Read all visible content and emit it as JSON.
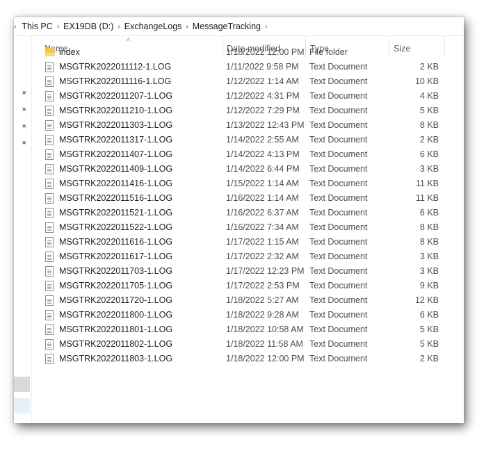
{
  "breadcrumb": {
    "items": [
      "This PC",
      "EX19DB (D:)",
      "ExchangeLogs",
      "MessageTracking"
    ]
  },
  "columns": {
    "name": "Name",
    "date_modified": "Date modified",
    "type": "Type",
    "size": "Size"
  },
  "files": [
    {
      "name": "index",
      "date": "1/18/2022 12:00 PM",
      "type": "File folder",
      "size": "",
      "icon": "folder-icon"
    },
    {
      "name": "MSGTRK2022011112-1.LOG",
      "date": "1/11/2022 9:58 PM",
      "type": "Text Document",
      "size": "2 KB",
      "icon": "text-document-icon"
    },
    {
      "name": "MSGTRK2022011116-1.LOG",
      "date": "1/12/2022 1:14 AM",
      "type": "Text Document",
      "size": "10 KB",
      "icon": "text-document-icon"
    },
    {
      "name": "MSGTRK2022011207-1.LOG",
      "date": "1/12/2022 4:31 PM",
      "type": "Text Document",
      "size": "4 KB",
      "icon": "text-document-icon"
    },
    {
      "name": "MSGTRK2022011210-1.LOG",
      "date": "1/12/2022 7:29 PM",
      "type": "Text Document",
      "size": "5 KB",
      "icon": "text-document-icon"
    },
    {
      "name": "MSGTRK2022011303-1.LOG",
      "date": "1/13/2022 12:43 PM",
      "type": "Text Document",
      "size": "8 KB",
      "icon": "text-document-icon"
    },
    {
      "name": "MSGTRK2022011317-1.LOG",
      "date": "1/14/2022 2:55 AM",
      "type": "Text Document",
      "size": "2 KB",
      "icon": "text-document-icon"
    },
    {
      "name": "MSGTRK2022011407-1.LOG",
      "date": "1/14/2022 4:13 PM",
      "type": "Text Document",
      "size": "6 KB",
      "icon": "text-document-icon"
    },
    {
      "name": "MSGTRK2022011409-1.LOG",
      "date": "1/14/2022 6:44 PM",
      "type": "Text Document",
      "size": "3 KB",
      "icon": "text-document-icon"
    },
    {
      "name": "MSGTRK2022011416-1.LOG",
      "date": "1/15/2022 1:14 AM",
      "type": "Text Document",
      "size": "11 KB",
      "icon": "text-document-icon"
    },
    {
      "name": "MSGTRK2022011516-1.LOG",
      "date": "1/16/2022 1:14 AM",
      "type": "Text Document",
      "size": "11 KB",
      "icon": "text-document-icon"
    },
    {
      "name": "MSGTRK2022011521-1.LOG",
      "date": "1/16/2022 6:37 AM",
      "type": "Text Document",
      "size": "6 KB",
      "icon": "text-document-icon"
    },
    {
      "name": "MSGTRK2022011522-1.LOG",
      "date": "1/16/2022 7:34 AM",
      "type": "Text Document",
      "size": "8 KB",
      "icon": "text-document-icon"
    },
    {
      "name": "MSGTRK2022011616-1.LOG",
      "date": "1/17/2022 1:15 AM",
      "type": "Text Document",
      "size": "8 KB",
      "icon": "text-document-icon"
    },
    {
      "name": "MSGTRK2022011617-1.LOG",
      "date": "1/17/2022 2:32 AM",
      "type": "Text Document",
      "size": "3 KB",
      "icon": "text-document-icon"
    },
    {
      "name": "MSGTRK2022011703-1.LOG",
      "date": "1/17/2022 12:23 PM",
      "type": "Text Document",
      "size": "3 KB",
      "icon": "text-document-icon"
    },
    {
      "name": "MSGTRK2022011705-1.LOG",
      "date": "1/17/2022 2:53 PM",
      "type": "Text Document",
      "size": "9 KB",
      "icon": "text-document-icon"
    },
    {
      "name": "MSGTRK2022011720-1.LOG",
      "date": "1/18/2022 5:27 AM",
      "type": "Text Document",
      "size": "12 KB",
      "icon": "text-document-icon"
    },
    {
      "name": "MSGTRK2022011800-1.LOG",
      "date": "1/18/2022 9:28 AM",
      "type": "Text Document",
      "size": "6 KB",
      "icon": "text-document-icon"
    },
    {
      "name": "MSGTRK2022011801-1.LOG",
      "date": "1/18/2022 10:58 AM",
      "type": "Text Document",
      "size": "5 KB",
      "icon": "text-document-icon"
    },
    {
      "name": "MSGTRK2022011802-1.LOG",
      "date": "1/18/2022 11:58 AM",
      "type": "Text Document",
      "size": "5 KB",
      "icon": "text-document-icon"
    },
    {
      "name": "MSGTRK2022011803-1.LOG",
      "date": "1/18/2022 12:00 PM",
      "type": "Text Document",
      "size": "2 KB",
      "icon": "text-document-icon"
    }
  ],
  "navpane": {
    "pins": [
      "pin-icon",
      "pin-icon",
      "pin-icon",
      "pin-icon"
    ]
  },
  "colors": {
    "header_text": "#4c607a",
    "selection_blue": "#e5f1fb",
    "folder": "#f4c84d"
  }
}
